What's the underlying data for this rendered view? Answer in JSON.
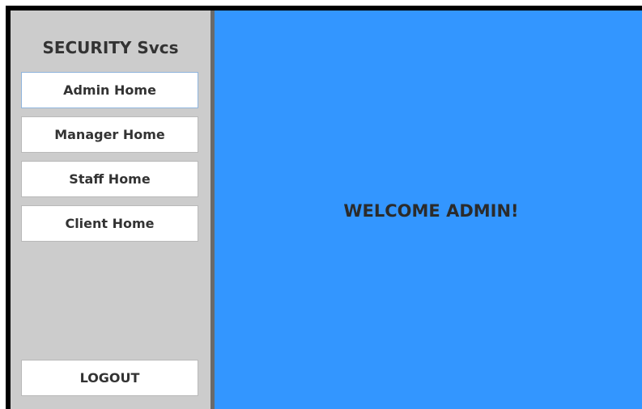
{
  "app": {
    "title": "SECURITY Svcs"
  },
  "sidebar": {
    "items": [
      {
        "label": "Admin Home",
        "active": true
      },
      {
        "label": "Manager Home",
        "active": false
      },
      {
        "label": "Staff Home",
        "active": false
      },
      {
        "label": "Client Home",
        "active": false
      }
    ],
    "logout_label": "LOGOUT"
  },
  "main": {
    "welcome_text": "WELCOME ADMIN!"
  },
  "colors": {
    "sidebar_bg": "#cccccc",
    "main_bg": "#3396ff",
    "divider": "#6a6a6a",
    "text": "#333333"
  }
}
